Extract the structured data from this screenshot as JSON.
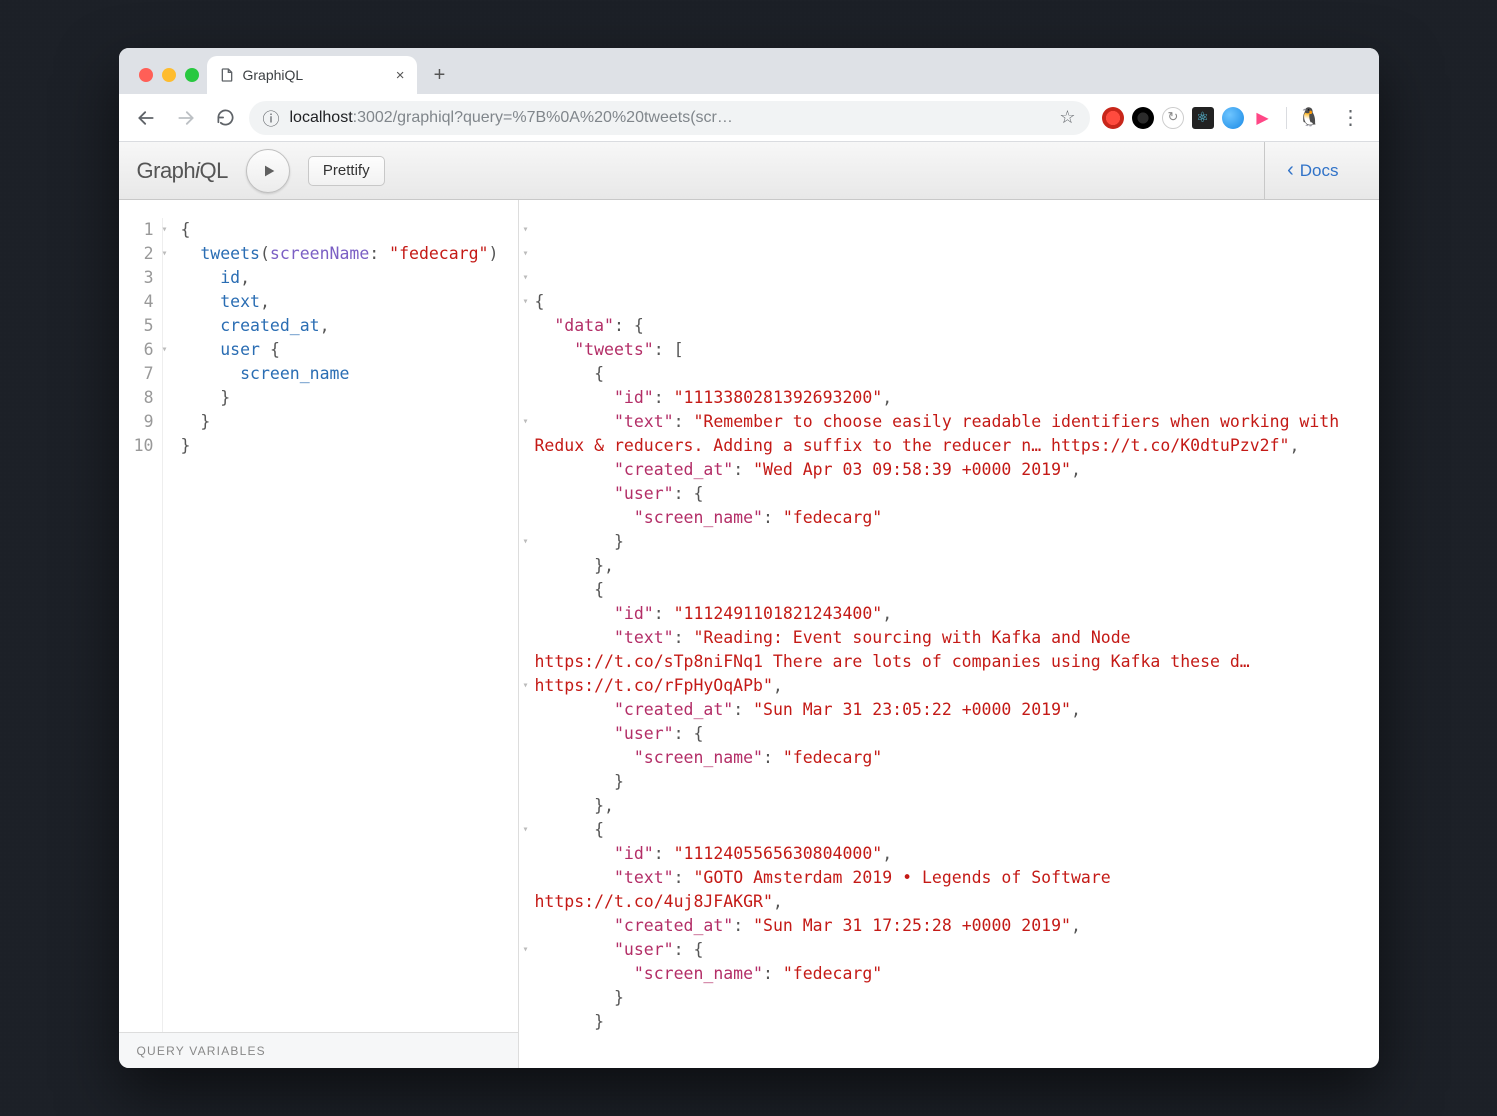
{
  "browser": {
    "tab_title": "GraphiQL",
    "url_host": "localhost",
    "url_rest": ":3002/graphiql?query=%7B%0A%20%20tweets(scr…",
    "new_tab_glyph": "+",
    "close_tab_glyph": "×"
  },
  "toolbar": {
    "logo_prefix": "Graph",
    "logo_i": "i",
    "logo_suffix": "QL",
    "prettify": "Prettify",
    "docs": "Docs",
    "docs_chevron": "‹"
  },
  "query": {
    "lines": [
      "1",
      "2",
      "3",
      "4",
      "5",
      "6",
      "7",
      "8",
      "9",
      "10"
    ],
    "fold_lines": [
      1,
      2,
      6
    ],
    "field_tweets": "tweets",
    "arg_name": "screenName",
    "arg_value": "\"fedecarg\"",
    "f_id": "id",
    "f_text": "text",
    "f_created": "created_at",
    "f_user": "user",
    "f_screen": "screen_name"
  },
  "qvars_label": "QUERY VARIABLES",
  "result": {
    "k_data": "\"data\"",
    "k_tweets": "\"tweets\"",
    "k_id": "\"id\"",
    "k_text": "\"text\"",
    "k_created": "\"created_at\"",
    "k_user": "\"user\"",
    "k_screen": "\"screen_name\"",
    "tweets": [
      {
        "id": "\"1113380281392693200\"",
        "text": "\"Remember to choose easily readable identifiers when working with Redux &amp; reducers. Adding a suffix to the reducer n… https://t.co/K0dtuPzv2f\"",
        "created_at": "\"Wed Apr 03 09:58:39 +0000 2019\"",
        "screen_name": "\"fedecarg\""
      },
      {
        "id": "\"1112491101821243400\"",
        "text": "\"Reading: Event sourcing with Kafka and Node https://t.co/sTp8niFNq1 There are lots of companies using Kafka these d… https://t.co/rFpHyOqAPb\"",
        "created_at": "\"Sun Mar 31 23:05:22 +0000 2019\"",
        "screen_name": "\"fedecarg\""
      },
      {
        "id": "\"1112405565630804000\"",
        "text": "\"GOTO Amsterdam 2019 • Legends of Software https://t.co/4uj8JFAKGR\"",
        "created_at": "\"Sun Mar 31 17:25:28 +0000 2019\"",
        "screen_name": "\"fedecarg\""
      }
    ]
  }
}
